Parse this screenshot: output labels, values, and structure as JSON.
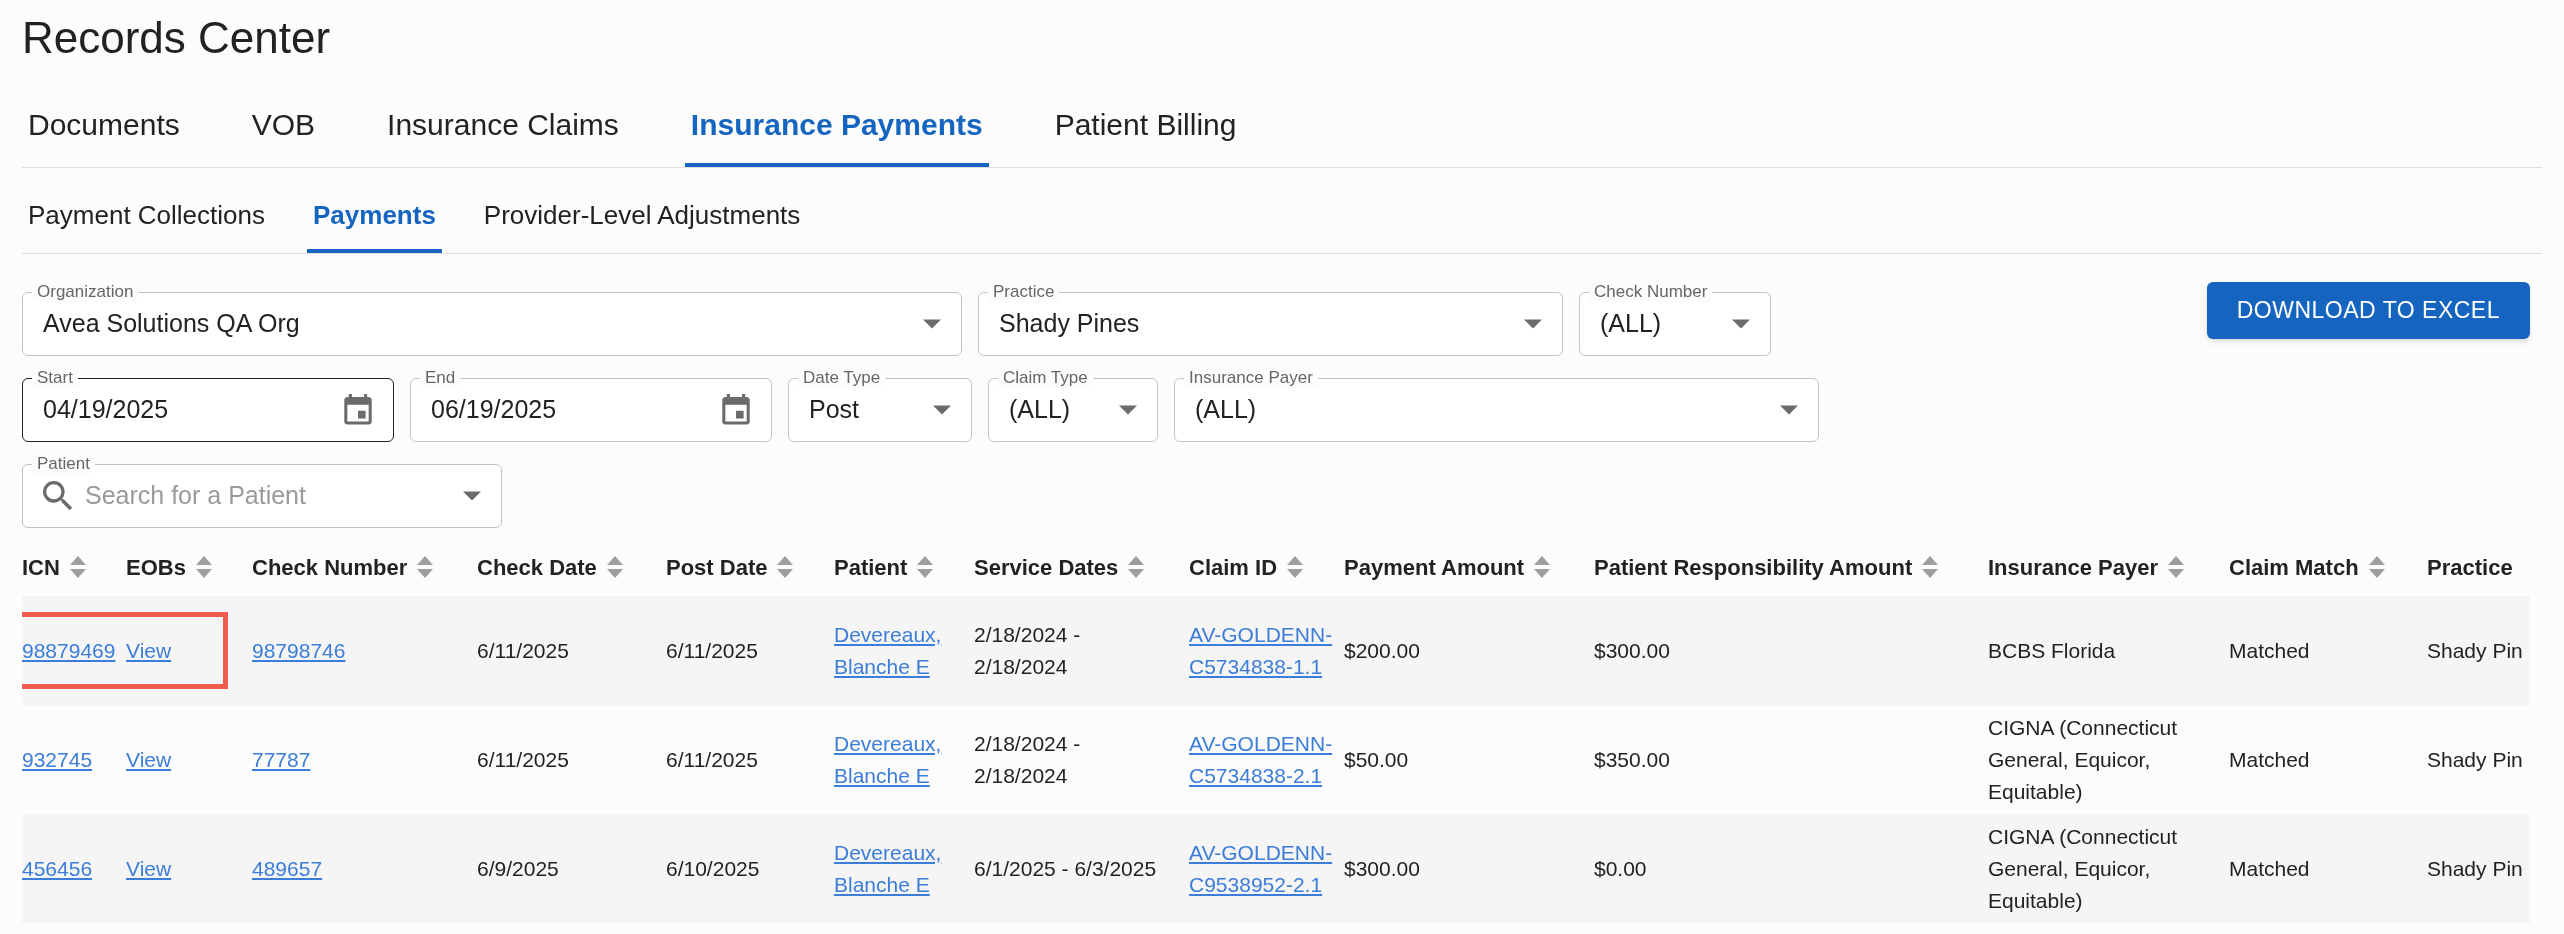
{
  "page_title": "Records Center",
  "tabs": [
    {
      "label": "Documents",
      "selected": false
    },
    {
      "label": "VOB",
      "selected": false
    },
    {
      "label": "Insurance Claims",
      "selected": false
    },
    {
      "label": "Insurance Payments",
      "selected": true
    },
    {
      "label": "Patient Billing",
      "selected": false
    }
  ],
  "subtabs": [
    {
      "label": "Payment Collections",
      "selected": false
    },
    {
      "label": "Payments",
      "selected": true
    },
    {
      "label": "Provider-Level Adjustments",
      "selected": false
    }
  ],
  "filter_rows": [
    [
      {
        "kind": "select",
        "label": "Organization",
        "value": "Avea Solutions QA Org",
        "focused": false
      },
      {
        "kind": "select",
        "label": "Practice",
        "value": "Shady Pines",
        "focused": false
      },
      {
        "kind": "select",
        "label": "Check Number",
        "value": "(ALL)",
        "focused": false
      }
    ],
    [
      {
        "kind": "date",
        "label": "Start",
        "value": "04/19/2025",
        "focused": true
      },
      {
        "kind": "date",
        "label": "End",
        "value": "06/19/2025",
        "focused": false
      },
      {
        "kind": "select",
        "label": "Date Type",
        "value": "Post",
        "focused": false
      },
      {
        "kind": "select",
        "label": "Claim Type",
        "value": "(ALL)",
        "focused": false
      },
      {
        "kind": "select",
        "label": "Insurance Payer",
        "value": "(ALL)",
        "focused": false
      }
    ],
    [
      {
        "kind": "search",
        "label": "Patient",
        "placeholder": "Search for a Patient",
        "focused": false
      }
    ]
  ],
  "download_button": "DOWNLOAD TO EXCEL",
  "table": {
    "columns": [
      {
        "label": "ICN",
        "sortable": true
      },
      {
        "label": "EOBs",
        "sortable": true
      },
      {
        "label": "Check Number",
        "sortable": true
      },
      {
        "label": "Check Date",
        "sortable": true
      },
      {
        "label": "Post Date",
        "sortable": true
      },
      {
        "label": "Patient",
        "sortable": true
      },
      {
        "label": "Service Dates",
        "sortable": true
      },
      {
        "label": "Claim ID",
        "sortable": true
      },
      {
        "label": "Payment Amount",
        "sortable": true
      },
      {
        "label": "Patient Responsibility Amount",
        "sortable": true
      },
      {
        "label": "Insurance Payer",
        "sortable": true
      },
      {
        "label": "Claim Match",
        "sortable": true
      },
      {
        "label": "Practice",
        "sortable": false
      }
    ],
    "rows": [
      {
        "highlighted": true,
        "icn": "98879469",
        "eob": "View",
        "check_number": "98798746",
        "check_date": "6/11/2025",
        "post_date": "6/11/2025",
        "patient": "Devereaux, Blanche E",
        "service_dates": "2/18/2024 - 2/18/2024",
        "claim_id": "AV-GOLDENN-C5734838-1.1",
        "payment_amount": "$200.00",
        "patient_responsibility": "$300.00",
        "insurance_payer": "BCBS Florida",
        "claim_match": "Matched",
        "practice": "Shady Pin"
      },
      {
        "highlighted": false,
        "icn": "932745",
        "eob": "View",
        "check_number": "77787",
        "check_date": "6/11/2025",
        "post_date": "6/11/2025",
        "patient": "Devereaux, Blanche E",
        "service_dates": "2/18/2024 - 2/18/2024",
        "claim_id": "AV-GOLDENN-C5734838-2.1",
        "payment_amount": "$50.00",
        "patient_responsibility": "$350.00",
        "insurance_payer": "CIGNA (Connecticut General, Equicor, Equitable)",
        "claim_match": "Matched",
        "practice": "Shady Pin"
      },
      {
        "highlighted": false,
        "icn": "456456",
        "eob": "View",
        "check_number": "489657",
        "check_date": "6/9/2025",
        "post_date": "6/10/2025",
        "patient": "Devereaux, Blanche E",
        "service_dates": "6/1/2025 - 6/3/2025",
        "claim_id": "AV-GOLDENN-C9538952-2.1",
        "payment_amount": "$300.00",
        "patient_responsibility": "$0.00",
        "insurance_payer": "CIGNA (Connecticut General, Equicor, Equitable)",
        "claim_match": "Matched",
        "practice": "Shady Pin"
      }
    ]
  }
}
